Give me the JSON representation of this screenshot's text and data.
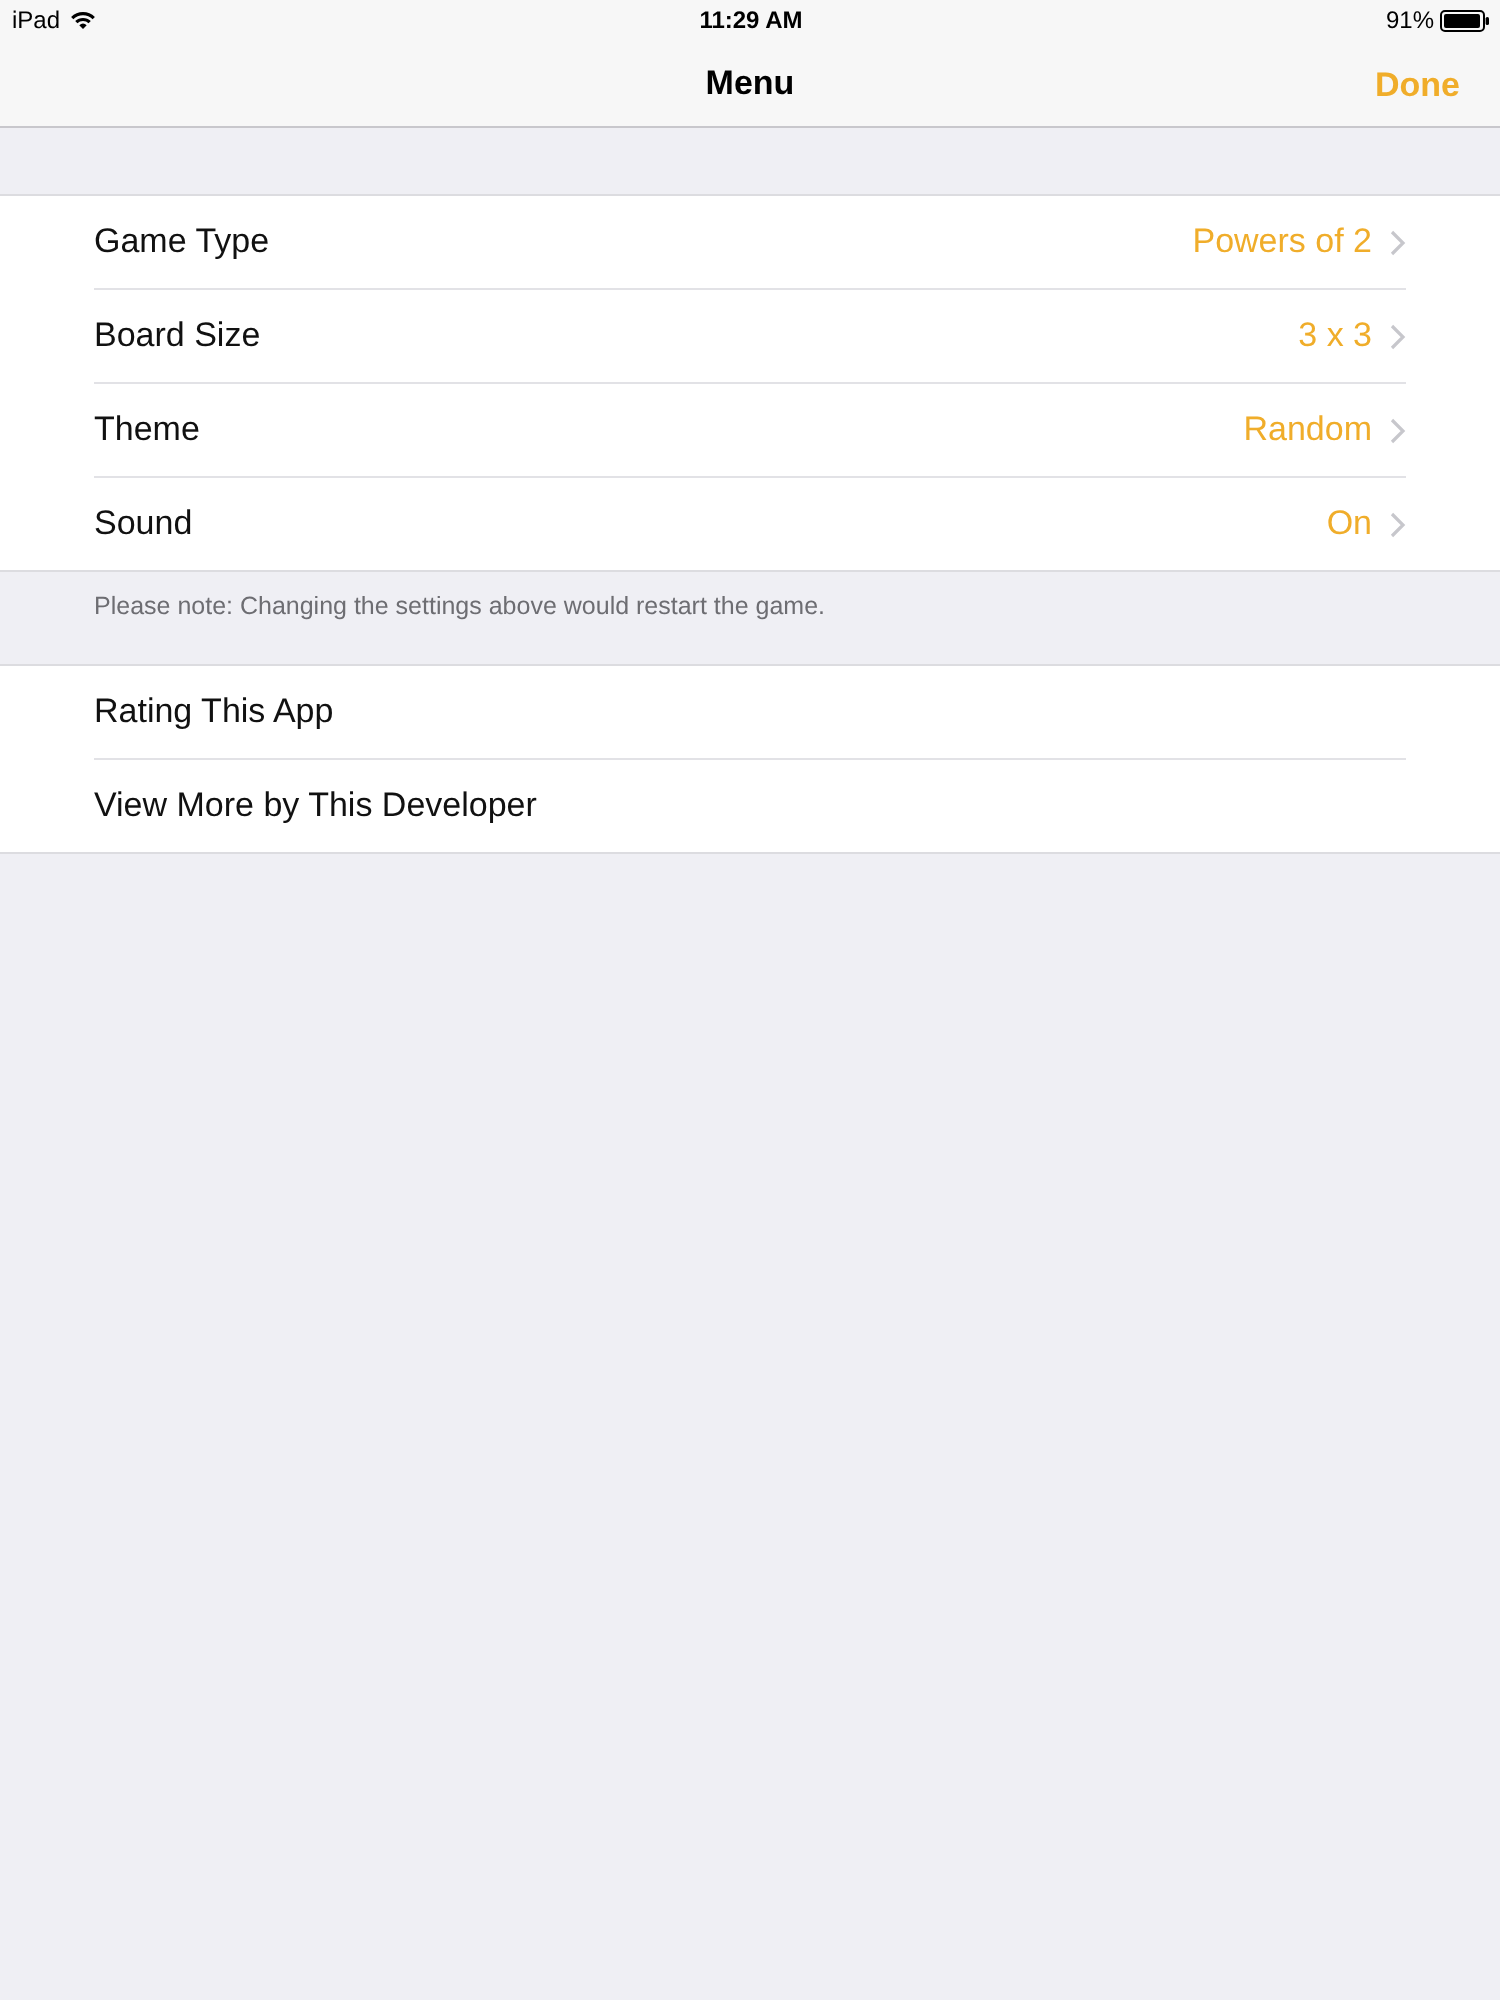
{
  "status_bar": {
    "device": "iPad",
    "time": "11:29 AM",
    "battery": "91%"
  },
  "nav_bar": {
    "title": "Menu",
    "done_button": "Done"
  },
  "settings": {
    "rows": [
      {
        "label": "Game Type",
        "value": "Powers of 2"
      },
      {
        "label": "Board Size",
        "value": "3 x 3"
      },
      {
        "label": "Theme",
        "value": "Random"
      },
      {
        "label": "Sound",
        "value": "On"
      }
    ],
    "footer": "Please note: Changing the settings above would restart the game."
  },
  "links": {
    "rows": [
      {
        "label": "Rating This App"
      },
      {
        "label": "View More by This Developer"
      }
    ]
  }
}
